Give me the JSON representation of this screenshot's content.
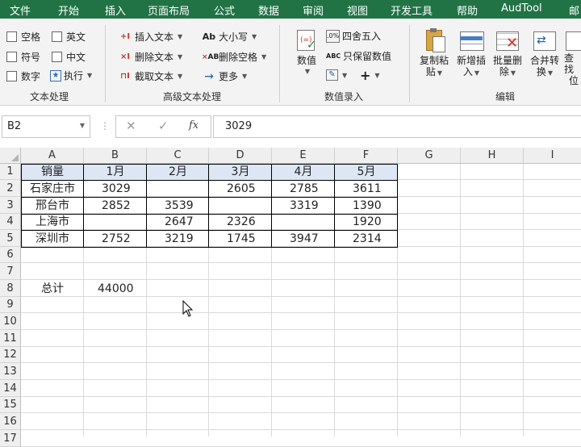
{
  "menu": {
    "tabs": [
      "文件",
      "开始",
      "插入",
      "页面布局",
      "公式",
      "数据",
      "审阅",
      "视图",
      "开发工具",
      "帮助",
      "AudTool",
      "邮"
    ]
  },
  "ribbon": {
    "text_processing": {
      "label": "文本处理",
      "options": [
        "空格",
        "英文",
        "符号",
        "中文",
        "数字"
      ],
      "execute": "执行"
    },
    "advanced_text": {
      "label": "高级文本处理",
      "insert_text": "插入文本",
      "delete_text": "删除文本",
      "extract_text": "截取文本",
      "case": "大小写",
      "delete_spaces": "删除空格",
      "more": "更多"
    },
    "numeric_entry": {
      "label": "数值录入",
      "values": "数值",
      "round": "四舍五入",
      "keep_values": "只保留数值"
    },
    "edit": {
      "label": "编辑",
      "copy_paste": [
        "复制粘",
        "贴"
      ],
      "insert_new": [
        "新增插",
        "入"
      ],
      "batch_delete": [
        "批量删",
        "除"
      ],
      "merge_convert": [
        "合并转",
        "换"
      ],
      "find_locate": [
        "查找",
        "位"
      ]
    }
  },
  "formula_bar": {
    "name_box": "B2",
    "formula": "3029",
    "fx": "fx"
  },
  "columns": [
    "A",
    "B",
    "C",
    "D",
    "E",
    "F",
    "G",
    "H",
    "I"
  ],
  "rows": [
    "1",
    "2",
    "3",
    "4",
    "5",
    "6",
    "7",
    "8",
    "9",
    "10",
    "11",
    "12",
    "13",
    "14",
    "15",
    "16",
    "17"
  ],
  "table": {
    "header": [
      "销量",
      "1月",
      "2月",
      "3月",
      "4月",
      "5月"
    ],
    "body": [
      [
        "石家庄市",
        "3029",
        "",
        "2605",
        "2785",
        "3611"
      ],
      [
        "邢台市",
        "2852",
        "3539",
        "",
        "3319",
        "1390"
      ],
      [
        "上海市",
        "",
        "2647",
        "2326",
        "",
        "1920"
      ],
      [
        "深圳市",
        "2752",
        "3219",
        "1745",
        "3947",
        "2314"
      ]
    ]
  },
  "total": {
    "label": "总计",
    "value": "44000"
  },
  "colors": {
    "brand": "#217346",
    "header_fill": "#dce6f5"
  }
}
